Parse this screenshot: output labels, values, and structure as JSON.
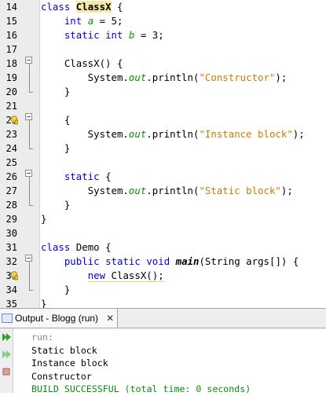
{
  "editor": {
    "lines": [
      {
        "n": "14",
        "html": "<span class=\"kw\">class</span> <span class=\"cls-hl\">ClassX</span> {"
      },
      {
        "n": "15",
        "html": "    <span class=\"kw\">int</span> <span class=\"fld\">a</span> = 5;"
      },
      {
        "n": "16",
        "html": "    <span class=\"kw\">static</span> <span class=\"kw\">int</span> <span class=\"sfld\">b</span> = 3;"
      },
      {
        "n": "17",
        "html": ""
      },
      {
        "n": "18",
        "html": "    ClassX() {"
      },
      {
        "n": "19",
        "html": "        System.<span class=\"sfld\">out</span>.println(<span class=\"str\">\"Constructor\"</span>);"
      },
      {
        "n": "20",
        "html": "    }"
      },
      {
        "n": "21",
        "html": ""
      },
      {
        "n": "22",
        "html": "    {"
      },
      {
        "n": "23",
        "html": "        System.<span class=\"sfld\">out</span>.println(<span class=\"str\">\"Instance block\"</span>);"
      },
      {
        "n": "24",
        "html": "    }"
      },
      {
        "n": "25",
        "html": ""
      },
      {
        "n": "26",
        "html": "    <span class=\"kw\">static</span> {"
      },
      {
        "n": "27",
        "html": "        System.<span class=\"sfld\">out</span>.println(<span class=\"str\">\"Static block\"</span>);"
      },
      {
        "n": "28",
        "html": "    }"
      },
      {
        "n": "29",
        "html": "}"
      },
      {
        "n": "30",
        "html": ""
      },
      {
        "n": "31",
        "html": "<span class=\"kw\">class</span> Demo {"
      },
      {
        "n": "32",
        "html": "    <span class=\"kw\">public</span> <span class=\"kw\">static</span> <span class=\"kw\">void</span> <span class=\"mth\">main</span>(String args[]) {"
      },
      {
        "n": "33",
        "html": "        <span class=\"warn-under\"><span class=\"kw\">new</span> ClassX();</span>"
      },
      {
        "n": "34",
        "html": "    }"
      },
      {
        "n": "35",
        "html": "}"
      }
    ]
  },
  "output": {
    "tab_label": "Output - Blogg (run)",
    "close_label": "✕",
    "lines": [
      {
        "text": "run:",
        "cls": "o-run"
      },
      {
        "text": "Static block",
        "cls": "o-norm"
      },
      {
        "text": "Instance block",
        "cls": "o-norm"
      },
      {
        "text": "Constructor",
        "cls": "o-norm"
      },
      {
        "text": "BUILD SUCCESSFUL (total time: 0 seconds)",
        "cls": "o-ok"
      }
    ]
  },
  "colors": {
    "keyword": "#0000e6",
    "string": "#ce7b00",
    "field": "#009900",
    "success": "#0f8a0f"
  },
  "icons": [
    "fold-collapse-icon",
    "lightbulb-warning-icon",
    "output-window-icon",
    "close-icon",
    "rerun-icon",
    "rerun-different-icon",
    "stop-icon"
  ]
}
